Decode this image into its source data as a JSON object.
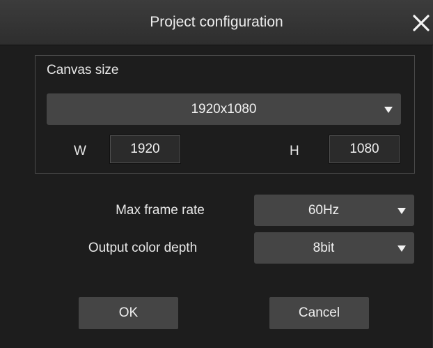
{
  "dialog": {
    "title": "Project configuration",
    "close_icon": "close-icon"
  },
  "canvas": {
    "group_label": "Canvas size",
    "preset_value": "1920x1080",
    "width_label": "W",
    "width_value": "1920",
    "height_label": "H",
    "height_value": "1080"
  },
  "settings": {
    "frame_rate_label": "Max frame rate",
    "frame_rate_value": "60Hz",
    "color_depth_label": "Output color depth",
    "color_depth_value": "8bit"
  },
  "buttons": {
    "ok_label": "OK",
    "cancel_label": "Cancel"
  },
  "colors": {
    "background": "#1d1d1d",
    "control": "#454545",
    "titlebar": "#333333",
    "text": "#e8e8e8"
  }
}
